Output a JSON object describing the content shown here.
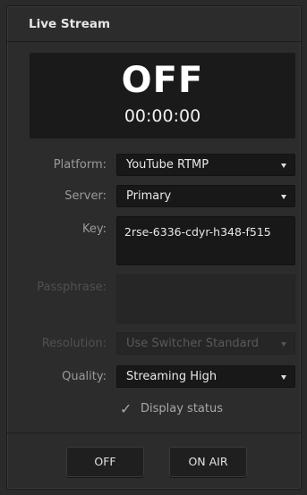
{
  "window": {
    "title": "Live Stream"
  },
  "status": {
    "state": "OFF",
    "timer": "00:00:00"
  },
  "form": {
    "platform": {
      "label": "Platform:",
      "value": "YouTube RTMP"
    },
    "server": {
      "label": "Server:",
      "value": "Primary"
    },
    "key": {
      "label": "Key:",
      "value": "2rse-6336-cdyr-h348-f515"
    },
    "passphrase": {
      "label": "Passphrase:",
      "value": ""
    },
    "resolution": {
      "label": "Resolution:",
      "value": "Use Switcher Standard"
    },
    "quality": {
      "label": "Quality:",
      "value": "Streaming High"
    },
    "display_status": {
      "label": "Display status",
      "checked": true
    }
  },
  "buttons": {
    "off": "OFF",
    "on_air": "ON AIR"
  },
  "icons": {
    "checkmark": "✓"
  }
}
